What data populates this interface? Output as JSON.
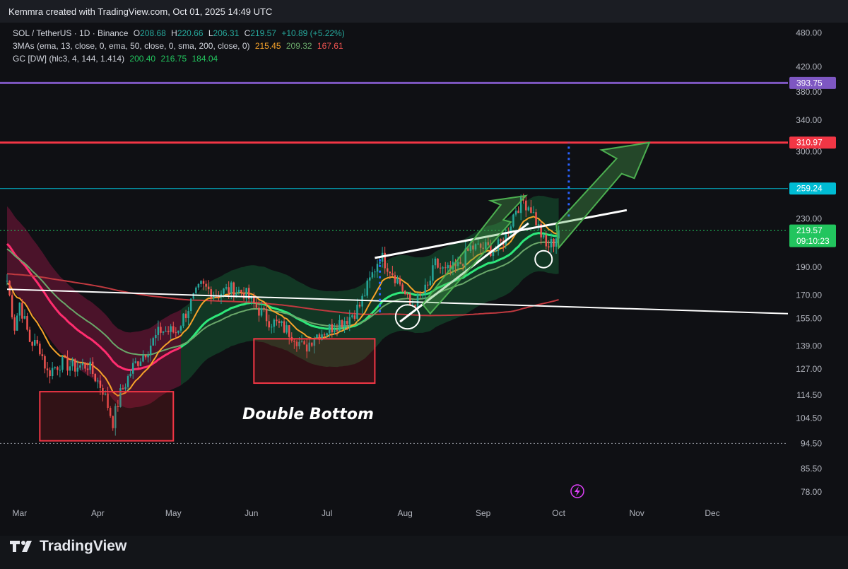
{
  "header": {
    "text": "Kemmra created with TradingView.com, Oct 01, 2025 14:49 UTC"
  },
  "legend": {
    "symbol": "SOL / TetherUS · 1D · Binance",
    "o_label": "O",
    "o_value": "208.68",
    "h_label": "H",
    "h_value": "220.66",
    "l_label": "L",
    "l_value": "206.31",
    "c_label": "C",
    "c_value": "219.57",
    "change": "+10.89 (+5.22%)",
    "ma_label": "3MAs (ema, 13, close, 0, ema, 50, close, 0, sma, 200, close, 0)",
    "ma_values": [
      "215.45",
      "209.32",
      "167.61"
    ],
    "gc_label": "GC [DW] (hlc3, 4, 144, 1.414)",
    "gc_values": [
      "200.40",
      "216.75",
      "184.04"
    ]
  },
  "colors": {
    "background": "#0f1014",
    "up": "#26a69a",
    "down": "#ef5350",
    "ema13": "#f7a32a",
    "ema50": "#6aa86a",
    "sma200": "#c0393f",
    "resistance_red": "#f23645",
    "purple_level": "#7e57c2",
    "cyan_level": "#00bcd4",
    "price_green": "#22c55e"
  },
  "brand": {
    "name": "TradingView",
    "icon": "tradingview-logo-icon"
  },
  "annotation": {
    "text": "Double Bottom"
  },
  "chart_data": {
    "type": "candlestick",
    "symbol": "SOL / TetherUS",
    "timeframe": "1D",
    "x_labels": [
      "Mar",
      "Apr",
      "May",
      "Jun",
      "Jul",
      "Aug",
      "Sep",
      "Oct",
      "Nov",
      "Dec"
    ],
    "y_scale": "log",
    "ylim": [
      75,
      500
    ],
    "y_ticks": [
      480.0,
      420.0,
      380.0,
      340.0,
      300.0,
      230.0,
      190.0,
      170.0,
      155.0,
      139.0,
      127.0,
      114.5,
      104.5,
      94.5,
      85.5,
      78.0
    ],
    "y_tick_labels": [
      "480.00",
      "420.00",
      "380.00",
      "340.00",
      "300.00",
      "230.00",
      "190.00",
      "170.00",
      "155.00",
      "139.00",
      "127.00",
      "114.50",
      "104.50",
      "94.50",
      "85.50",
      "78.00"
    ],
    "price_levels": [
      {
        "value": 393.75,
        "label": "393.75",
        "color": "#7e57c2"
      },
      {
        "value": 310.97,
        "label": "310.97",
        "color": "#f23645"
      },
      {
        "value": 259.24,
        "label": "259.24",
        "color": "#00bcd4"
      }
    ],
    "last_price": {
      "value": 219.57,
      "label": "219.57",
      "countdown": "09:10:23"
    },
    "support_line": {
      "value": 94.5
    },
    "path": [
      [
        "2025-02-24",
        180
      ],
      [
        "2025-02-27",
        150
      ],
      [
        "2025-03-01",
        165
      ],
      [
        "2025-03-05",
        142
      ],
      [
        "2025-03-09",
        138
      ],
      [
        "2025-03-12",
        125
      ],
      [
        "2025-03-17",
        130
      ],
      [
        "2025-03-23",
        128
      ],
      [
        "2025-03-28",
        129
      ],
      [
        "2025-04-03",
        117
      ],
      [
        "2025-04-07",
        103
      ],
      [
        "2025-04-10",
        115
      ],
      [
        "2025-04-15",
        128
      ],
      [
        "2025-04-21",
        138
      ],
      [
        "2025-04-26",
        148
      ],
      [
        "2025-05-02",
        147
      ],
      [
        "2025-05-08",
        165
      ],
      [
        "2025-05-12",
        176
      ],
      [
        "2025-05-18",
        171
      ],
      [
        "2025-05-24",
        174
      ],
      [
        "2025-05-29",
        172
      ],
      [
        "2025-06-03",
        162
      ],
      [
        "2025-06-08",
        154
      ],
      [
        "2025-06-13",
        150
      ],
      [
        "2025-06-18",
        145
      ],
      [
        "2025-06-22",
        137
      ],
      [
        "2025-06-26",
        145
      ],
      [
        "2025-07-01",
        148
      ],
      [
        "2025-07-05",
        152
      ],
      [
        "2025-07-10",
        156
      ],
      [
        "2025-07-14",
        163
      ],
      [
        "2025-07-18",
        180
      ],
      [
        "2025-07-22",
        199
      ],
      [
        "2025-07-26",
        189
      ],
      [
        "2025-07-30",
        178
      ],
      [
        "2025-08-03",
        163
      ],
      [
        "2025-08-06",
        167
      ],
      [
        "2025-08-10",
        175
      ],
      [
        "2025-08-13",
        192
      ],
      [
        "2025-08-17",
        186
      ],
      [
        "2025-08-22",
        190
      ],
      [
        "2025-08-27",
        205
      ],
      [
        "2025-09-02",
        205
      ],
      [
        "2025-09-06",
        203
      ],
      [
        "2025-09-10",
        215
      ],
      [
        "2025-09-14",
        240
      ],
      [
        "2025-09-17",
        247
      ],
      [
        "2025-09-20",
        240
      ],
      [
        "2025-09-23",
        222
      ],
      [
        "2025-09-26",
        205
      ],
      [
        "2025-09-29",
        210
      ],
      [
        "2025-10-01",
        219.57
      ]
    ]
  }
}
